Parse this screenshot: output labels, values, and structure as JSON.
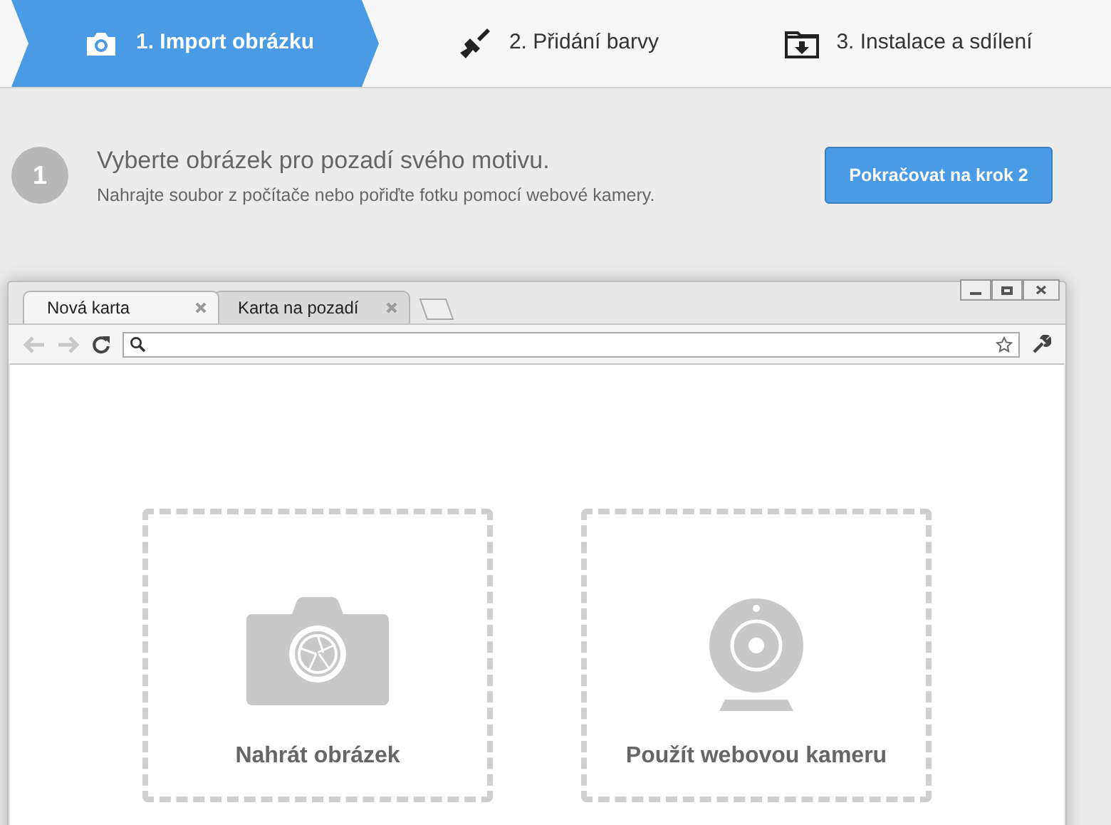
{
  "steps": [
    {
      "label": "1. Import obrázku",
      "selected": true
    },
    {
      "label": "2. Přidání barvy",
      "selected": false
    },
    {
      "label": "3. Instalace a sdílení",
      "selected": false
    }
  ],
  "intro": {
    "number": "1",
    "title": "Vyberte obrázek pro pozadí svého motivu.",
    "subtitle": "Nahrajte soubor z počítače nebo pořiďte fotku pomocí webové kamery.",
    "button": "Pokračovat na krok 2"
  },
  "browser": {
    "tabs": [
      {
        "label": "Nová karta",
        "selected": true
      },
      {
        "label": "Karta na pozadí",
        "selected": false
      }
    ],
    "options": [
      {
        "label": "Nahrát obrázek"
      },
      {
        "label": "Použít webovou kameru"
      }
    ]
  }
}
